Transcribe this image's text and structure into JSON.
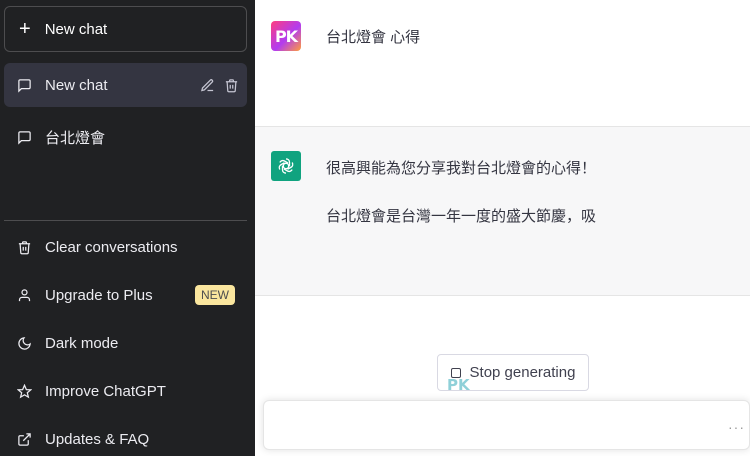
{
  "sidebar": {
    "new_chat_label": "New chat",
    "conversations": [
      {
        "label": "New chat",
        "active": true
      },
      {
        "label": "台北燈會",
        "active": false
      }
    ],
    "menu": [
      {
        "label": "Clear conversations",
        "icon": "trash-icon"
      },
      {
        "label": "Upgrade to Plus",
        "icon": "user-icon",
        "badge": "NEW"
      },
      {
        "label": "Dark mode",
        "icon": "moon-icon"
      },
      {
        "label": "Improve ChatGPT",
        "icon": "star-icon"
      },
      {
        "label": "Updates & FAQ",
        "icon": "external-link-icon"
      }
    ]
  },
  "chat": {
    "user_avatar_text": "PK",
    "user_message": "台北燈會 心得",
    "assistant_paragraphs": [
      "很高興能為您分享我對台北燈會的心得！",
      "台北燈會是台灣一年一度的盛大節慶，吸"
    ],
    "stop_label": "Stop generating",
    "input_placeholder": "",
    "input_more": "···"
  },
  "watermark": "PK",
  "colors": {
    "sidebar_bg": "#202123",
    "active_conv_bg": "#343541",
    "assistant_bg": "#f7f7f8",
    "gpt_green": "#10a37f",
    "badge_bg": "#fae69e"
  }
}
